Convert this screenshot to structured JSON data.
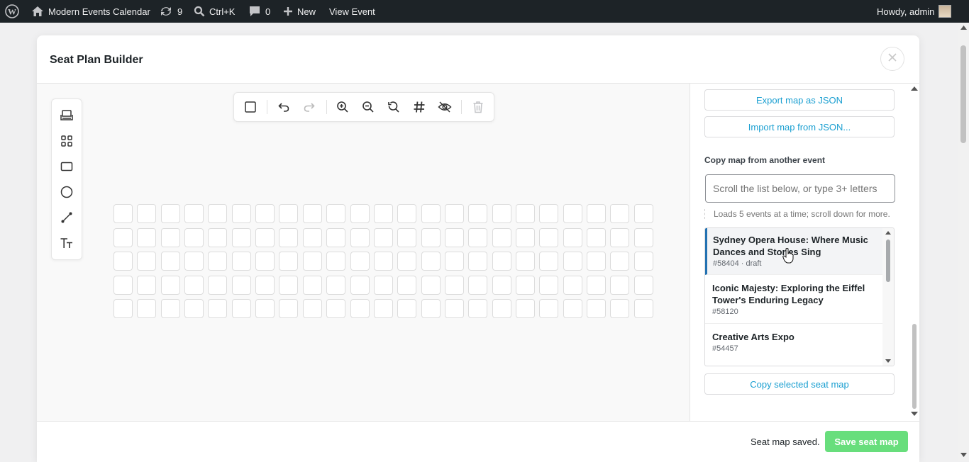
{
  "adminbar": {
    "site_name": "Modern Events Calendar",
    "updates_count": "9",
    "search_shortcut": "Ctrl+K",
    "comments_count": "0",
    "new_label": "New",
    "view_event_label": "View Event",
    "howdy_label": "Howdy, admin"
  },
  "modal": {
    "title": "Seat Plan Builder",
    "palette_tools": [
      "seat-icon",
      "seat-grid-icon",
      "rectangle-icon",
      "circle-icon",
      "line-icon",
      "text-icon"
    ],
    "toolbar_tools": [
      "select-icon",
      "undo-icon",
      "redo-icon",
      "zoom-in-icon",
      "zoom-out-icon",
      "zoom-reset-icon",
      "grid-icon",
      "visibility-off-icon",
      "delete-icon"
    ],
    "seat_grid": {
      "rows": 5,
      "columns": 23
    }
  },
  "sidepanel": {
    "export_label": "Export map as JSON",
    "import_label": "Import map from JSON...",
    "copy_section_label": "Copy map from another event",
    "search_placeholder": "Scroll the list below, or type 3+ letters",
    "search_value": "",
    "hint": "Loads 5 events at a time; scroll down for more.",
    "events": [
      {
        "title": "Sydney Opera House: Where Music Dances and Stories Sing",
        "meta": "#58404 · draft",
        "selected": true
      },
      {
        "title": "Iconic Majesty: Exploring the Eiffel Tower's Enduring Legacy",
        "meta": "#58120",
        "selected": false
      },
      {
        "title": "Creative Arts Expo",
        "meta": "#54457",
        "selected": false
      }
    ],
    "copy_button_label": "Copy selected seat map"
  },
  "footer": {
    "status": "Seat map saved.",
    "save_label": "Save seat map"
  },
  "colors": {
    "adminbar_bg": "#1d2327",
    "link_blue": "#1a9fd1",
    "save_green": "#68de7c",
    "selected_accent": "#2271b1"
  }
}
